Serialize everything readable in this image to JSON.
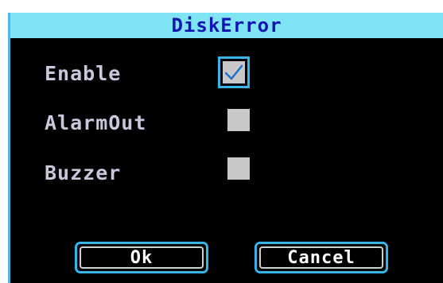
{
  "dialog": {
    "title": "DiskError",
    "options": [
      {
        "label": "Enable",
        "checked": true
      },
      {
        "label": "AlarmOut",
        "checked": false
      },
      {
        "label": "Buzzer",
        "checked": false
      }
    ],
    "buttons": {
      "ok_label": "Ok",
      "cancel_label": "Cancel"
    }
  },
  "colors": {
    "title_bar": "#7fe4f4",
    "title_text": "#1414b4",
    "background": "#000000",
    "focus_accent": "#38b4e8",
    "checkbox_fill": "#c8c8c8",
    "label_text": "#c8c8dc"
  },
  "icons": {
    "checkmark": "checkmark-icon"
  }
}
